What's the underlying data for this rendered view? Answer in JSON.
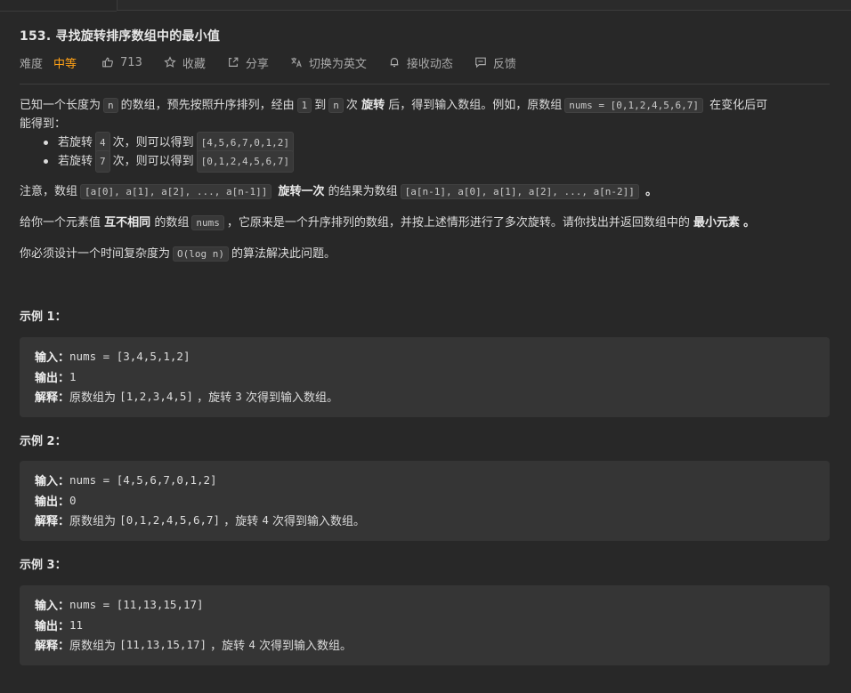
{
  "problem": {
    "title": "153. 寻找旋转排序数组中的最小值",
    "meta": {
      "difficulty_label": "难度",
      "difficulty_value": "中等",
      "likes": "713",
      "favorite_label": "收藏",
      "share_label": "分享",
      "switch_lang_label": "切换为英文",
      "subscribe_label": "接收动态",
      "feedback_label": "反馈"
    },
    "paragraph1": {
      "t1": "已知一个长度为",
      "c1": "n",
      "t2": "的数组，预先按照升序排列，经由",
      "c2": "1",
      "t3": "到",
      "c3": "n",
      "t4": "次",
      "b1": "旋转",
      "t5": "后，得到输入数组。例如，原数组",
      "c4": "nums = [0,1,2,4,5,6,7]",
      "t6": "在变化后可",
      "t7": "能得到："
    },
    "bullets": [
      {
        "a": "若旋转",
        "c1": "4",
        "b": "次，则可以得到",
        "c2": "[4,5,6,7,0,1,2]"
      },
      {
        "a": "若旋转",
        "c1": "7",
        "b": "次，则可以得到",
        "c2": "[0,1,2,4,5,6,7]"
      }
    ],
    "note": {
      "t1": "注意，数组",
      "c1": "[a[0], a[1], a[2], ..., a[n-1]]",
      "b1": "旋转一次",
      "t2": "的结果为数组",
      "c2": "[a[n-1], a[0], a[1], a[2], ..., a[n-2]]",
      "t3": "。"
    },
    "give": {
      "t1": "给你一个元素值",
      "b1": "互不相同",
      "t2": "的数组",
      "c1": "nums",
      "t3": "，它原来是一个升序排列的数组，并按上述情形进行了多次旋转。请你找出并返回数组中的",
      "b2": "最小元素",
      "t4": "。"
    },
    "must": {
      "t1": "你必须设计一个时间复杂度为",
      "c1": "O(log n)",
      "t2": "的算法解决此问题。"
    },
    "examples": [
      {
        "title": "示例 1：",
        "input_label": "输入：",
        "input_value": "nums = [3,4,5,1,2]",
        "output_label": "输出：",
        "output_value": "1",
        "explain_label": "解释：",
        "explain_text_1": "原数组为",
        "explain_code_1": "[1,2,3,4,5]",
        "explain_text_2": "，旋转",
        "explain_code_2": "3",
        "explain_text_3": "次得到输入数组。"
      },
      {
        "title": "示例 2：",
        "input_label": "输入：",
        "input_value": "nums = [4,5,6,7,0,1,2]",
        "output_label": "输出：",
        "output_value": "0",
        "explain_label": "解释：",
        "explain_text_1": "原数组为",
        "explain_code_1": "[0,1,2,4,5,6,7]",
        "explain_text_2": "，旋转",
        "explain_code_2": "4",
        "explain_text_3": "次得到输入数组。"
      },
      {
        "title": "示例 3：",
        "input_label": "输入：",
        "input_value": "nums = [11,13,15,17]",
        "output_label": "输出：",
        "output_value": "11",
        "explain_label": "解释：",
        "explain_text_1": "原数组为",
        "explain_code_1": "[11,13,15,17]",
        "explain_text_2": "，旋转",
        "explain_code_2": "4",
        "explain_text_3": "次得到输入数组。"
      }
    ]
  },
  "colors": {
    "background": "#282828",
    "difficulty_medium": "#ffa116",
    "example_box": "#353535",
    "inline_code_bg": "#383838"
  },
  "icons": {
    "like": "thumbs-up-icon",
    "favorite": "star-icon",
    "share": "share-icon",
    "switch_lang": "translate-icon",
    "subscribe": "bell-icon",
    "feedback": "message-icon"
  }
}
